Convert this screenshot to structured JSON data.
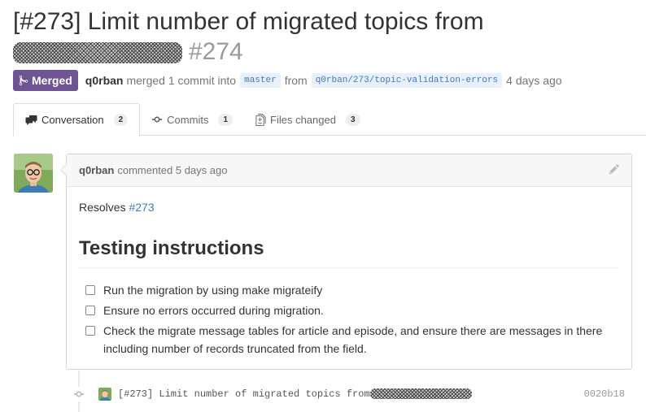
{
  "pr": {
    "title_text": "[#273] Limit number of migrated topics from",
    "number": "#274",
    "state_label": "Merged",
    "state_color": "#6e5494",
    "author": "q0rban",
    "merged_text": "merged 1 commit into",
    "base_branch": "master",
    "from_text": "from",
    "head_branch": "q0rban/273/topic-validation-errors",
    "time_ago": "4 days ago"
  },
  "tabs": [
    {
      "label": "Conversation",
      "count": "2",
      "icon": "comment-discussion-icon",
      "selected": true
    },
    {
      "label": "Commits",
      "count": "1",
      "icon": "git-commit-icon",
      "selected": false
    },
    {
      "label": "Files changed",
      "count": "3",
      "icon": "diff-icon",
      "selected": false
    }
  ],
  "comment": {
    "author": "q0rban",
    "action": "commented 5 days ago",
    "resolves_text": "Resolves",
    "resolves_link": "#273",
    "heading": "Testing instructions",
    "tasks": [
      "Run the migration by using make migrateify",
      "Ensure no errors occurred during migration.",
      "Check the migrate message tables for article and episode, and ensure there are messages in there including number of records truncated from the field."
    ]
  },
  "commit": {
    "message": "[#273] Limit number of migrated topics from",
    "sha": "0020b18"
  },
  "colors": {
    "link": "#4078c0",
    "merged": "#6e5494",
    "muted": "#767676"
  }
}
